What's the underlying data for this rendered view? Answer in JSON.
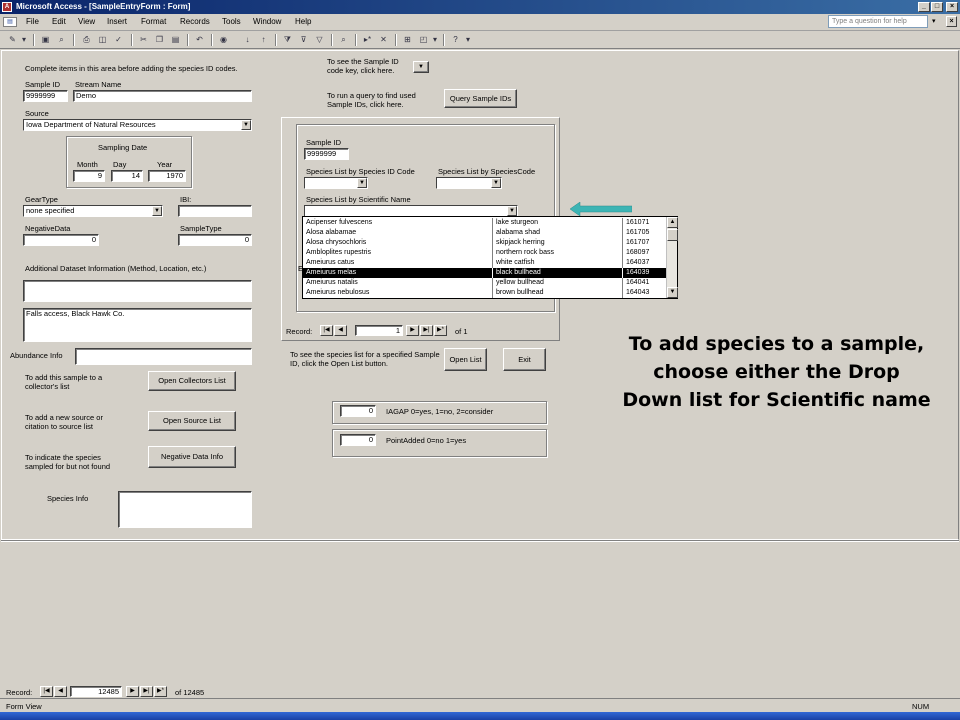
{
  "window": {
    "title": "Microsoft Access - [SampleEntryForm : Form]",
    "controls": [
      "_",
      "□",
      "×"
    ]
  },
  "menubar": {
    "items": [
      "File",
      "Edit",
      "View",
      "Insert",
      "Format",
      "Records",
      "Tools",
      "Window",
      "Help"
    ],
    "help_placeholder": "Type a question for help"
  },
  "form": {
    "instruction": "Complete items in this area before adding the species ID codes.",
    "sample_id_label": "Sample ID",
    "sample_id_value": "9999999",
    "stream_name_label": "Stream Name",
    "stream_name_value": "Demo",
    "source_label": "Source",
    "source_value": "Iowa Department of Natural Resources",
    "sampling_date_label": "Sampling Date",
    "month_label": "Month",
    "month_value": "9",
    "day_label": "Day",
    "day_value": "14",
    "year_label": "Year",
    "year_value": "1970",
    "geartype_label": "GearType",
    "geartype_value": "none specified",
    "ibi_label": "IBI:",
    "negativedata_label": "NegativeData",
    "negativedata_value": "0",
    "sampletype_label": "SampleType",
    "sampletype_value": "0",
    "additional_label": "Additional Dataset Information (Method, Location, etc.)",
    "additional_value": "",
    "location_value": "Falls access, Black Hawk Co.",
    "abundance_label": "Abundance Info",
    "collectors_text": "To add this sample to a collector's list",
    "collectors_button": "Open Collectors List",
    "source_text": "To add a new source or citation to source list",
    "source_button": "Open Source List",
    "negative_text": "To indicate the species sampled for but not found",
    "negative_button": "Negative Data Info",
    "species_info_label": "Species Info",
    "samplekey_text": "To see the Sample ID code key, click here.",
    "query_text": "To run a query to find used Sample IDs, click here.",
    "query_button": "Query Sample IDs",
    "openlist_text": "To see the species list for a specified Sample ID, click the Open List button.",
    "openlist_button": "Open List",
    "exit_button": "Exit",
    "iagap_value": "0",
    "iagap_label": "IAGAP  0=yes, 1=no, 2=consider",
    "pointadded_value": "0",
    "pointadded_label": "PointAdded 0=no 1=yes"
  },
  "subform": {
    "sample_id_label": "Sample ID",
    "sample_id_value": "9999999",
    "by_id_label": "Species List by Species ID Code",
    "by_code_label": "Species List by SpeciesCode",
    "by_sci_label": "Species List by Scientific Name",
    "record_label": "Record:",
    "record_value": "1",
    "record_of": "of  1",
    "hidden_label_letter": "E"
  },
  "species_dropdown": {
    "rows": [
      {
        "sci": "Acipenser fulvescens",
        "common": "lake sturgeon",
        "code": "161071"
      },
      {
        "sci": "Alosa alabamae",
        "common": "alabama shad",
        "code": "161705"
      },
      {
        "sci": "Alosa chrysochloris",
        "common": "skipjack herring",
        "code": "161707"
      },
      {
        "sci": "Ambloplites rupestris",
        "common": "northern rock bass",
        "code": "168097"
      },
      {
        "sci": "Ameiurus catus",
        "common": "white catfish",
        "code": "164037"
      },
      {
        "sci": "Ameiurus melas",
        "common": "black bullhead",
        "code": "164039"
      },
      {
        "sci": "Ameiurus natalis",
        "common": "yellow bullhead",
        "code": "164041"
      },
      {
        "sci": "Ameiurus nebulosus",
        "common": "brown bullhead",
        "code": "164043"
      }
    ],
    "selected_index": 5
  },
  "record_nav": {
    "label": "Record:",
    "value": "12485",
    "of": "of  12485"
  },
  "status": {
    "left": "Form View",
    "right": "NUM"
  },
  "caption": {
    "line1": "To add species to a sample,",
    "line2": "choose either the Drop",
    "line3": "Down list for Scientific name"
  },
  "colors": {
    "titlebar": "#0a246a",
    "arrow": "#3cb4b4",
    "selection": "#000000"
  }
}
